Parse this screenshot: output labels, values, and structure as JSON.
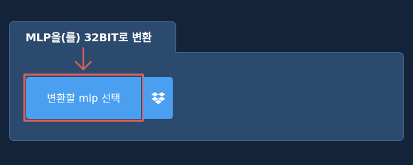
{
  "converter": {
    "title": "MLP을(를) 32BIT로 변환",
    "select_button_label": "변환할 mlp 선택",
    "dropbox_icon": "dropbox-icon"
  },
  "colors": {
    "page_background": "#13233a",
    "panel_background": "#2c4a6d",
    "button_blue": "#4a9ff0",
    "highlight_red": "#d9605a"
  }
}
